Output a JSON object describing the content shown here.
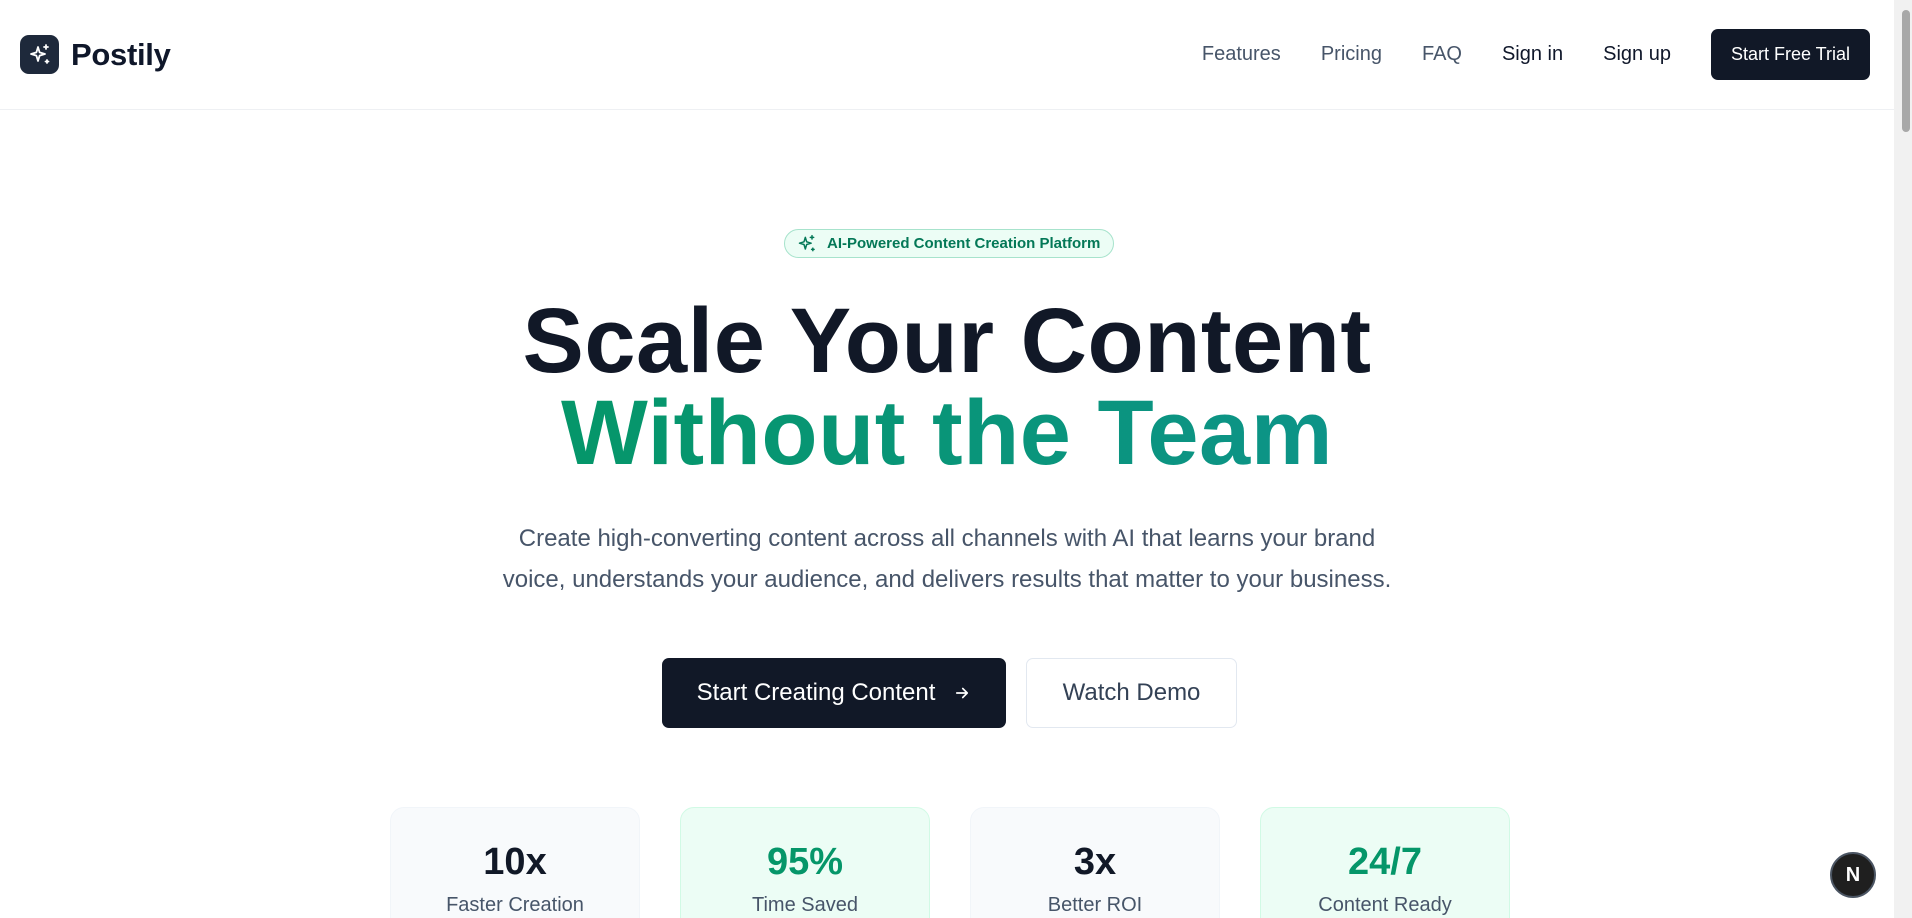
{
  "header": {
    "brand_name": "Postily",
    "nav_links": [
      "Features",
      "Pricing",
      "FAQ"
    ],
    "sign_in": "Sign in",
    "sign_up": "Sign up",
    "trial_button": "Start Free Trial"
  },
  "hero": {
    "badge": "AI-Powered Content Creation Platform",
    "title_line1": "Scale Your Content",
    "title_line2": "Without the Team",
    "subtitle_line1": "Create high-converting content across all channels with AI that learns your brand",
    "subtitle_line2": "voice, understands your audience, and delivers results that matter to your business.",
    "primary_cta": "Start Creating Content",
    "secondary_cta": "Watch Demo"
  },
  "stats": [
    {
      "value": "10x",
      "label": "Faster Creation",
      "style": "gray"
    },
    {
      "value": "95%",
      "label": "Time Saved",
      "style": "green"
    },
    {
      "value": "3x",
      "label": "Better ROI",
      "style": "gray"
    },
    {
      "value": "24/7",
      "label": "Content Ready",
      "style": "green"
    }
  ],
  "floating_badge": "N",
  "colors": {
    "primary_dark": "#111827",
    "accent_green": "#059669",
    "badge_bg": "#ecfdf5",
    "text_muted": "#475569"
  },
  "icons": {
    "brand": "sparkles-icon",
    "badge": "sparkles-icon",
    "cta": "arrow-right-icon"
  }
}
